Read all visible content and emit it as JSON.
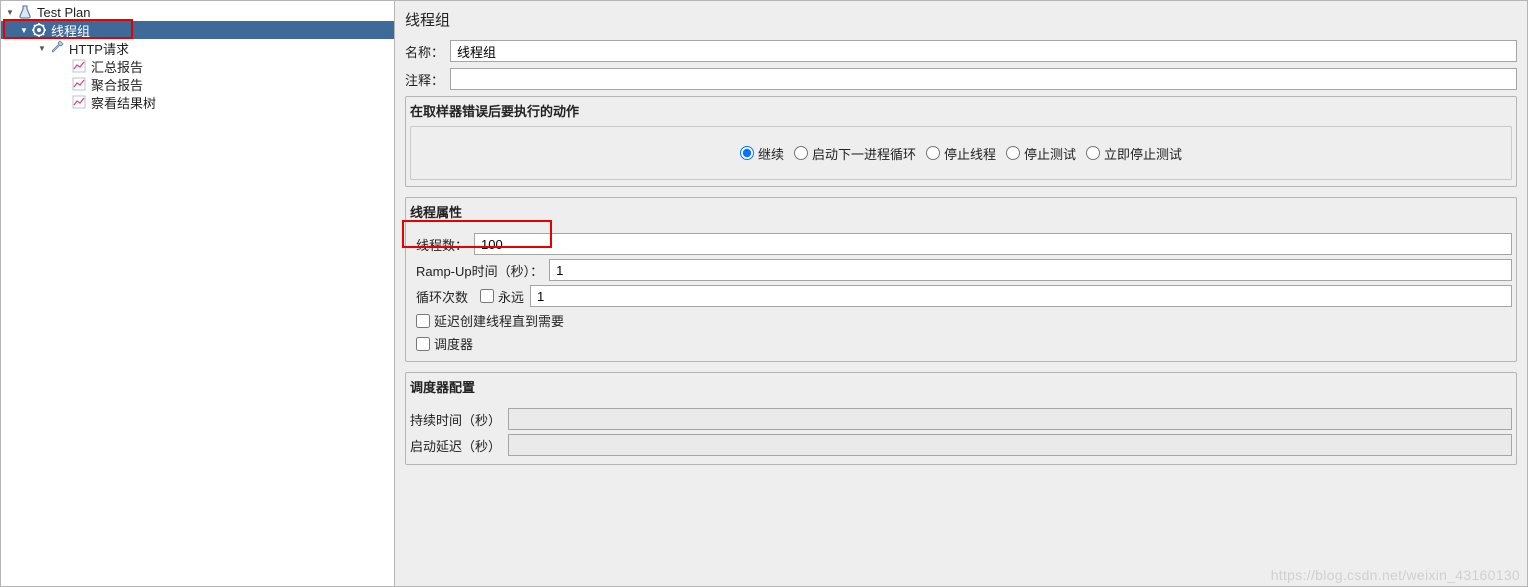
{
  "tree": {
    "root": "Test Plan",
    "thread_group": "线程组",
    "http_request": "HTTP请求",
    "summary_report": "汇总报告",
    "aggregate_report": "聚合报告",
    "view_results_tree": "察看结果树"
  },
  "panel": {
    "title": "线程组",
    "name_label": "名称：",
    "name_value": "线程组",
    "comments_label": "注释：",
    "comments_value": ""
  },
  "on_error": {
    "title": "在取样器错误后要执行的动作",
    "options": {
      "continue": "继续",
      "start_next": "启动下一进程循环",
      "stop_thread": "停止线程",
      "stop_test": "停止测试",
      "stop_test_now": "立即停止测试"
    },
    "selected": "continue"
  },
  "thread_props": {
    "title": "线程属性",
    "threads_label": "线程数：",
    "threads_value": "100",
    "rampup_label": "Ramp-Up时间（秒）：",
    "rampup_value": "1",
    "loops_label": "循环次数",
    "forever_label": "永远",
    "loops_value": "1",
    "delay_create_label": "延迟创建线程直到需要",
    "scheduler_label": "调度器"
  },
  "scheduler": {
    "title": "调度器配置",
    "duration_label": "持续时间（秒）",
    "duration_value": "",
    "delay_label": "启动延迟（秒）",
    "delay_value": ""
  },
  "watermark": "https://blog.csdn.net/weixin_43160130"
}
